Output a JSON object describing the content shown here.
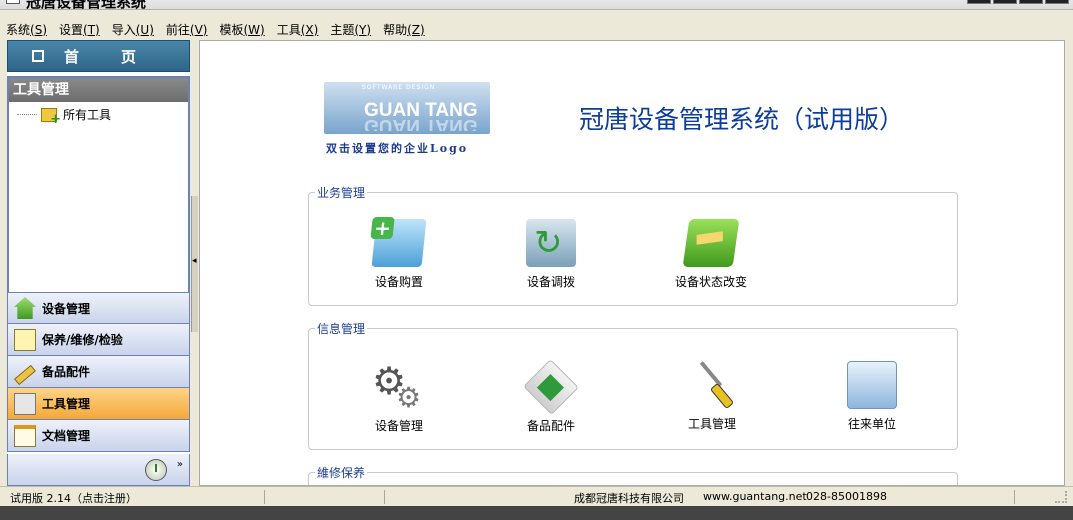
{
  "window": {
    "title": "冠唐设备管理系统"
  },
  "menubar": {
    "items": [
      {
        "label": "系统",
        "accel": "(S)"
      },
      {
        "label": "设置",
        "accel": "(T)"
      },
      {
        "label": "导入",
        "accel": "(U)"
      },
      {
        "label": "前往",
        "accel": "(V)"
      },
      {
        "label": "模板",
        "accel": "(W)"
      },
      {
        "label": "工具",
        "accel": "(X)"
      },
      {
        "label": "主题",
        "accel": "(Y)"
      },
      {
        "label": "帮助",
        "accel": "(Z)"
      }
    ]
  },
  "sidebar": {
    "home_label": "首页",
    "tree_header": "工具管理",
    "tree_item": "所有工具",
    "nav": [
      {
        "label": "设备管理",
        "icon": "house-icon"
      },
      {
        "label": "保养/维修/检验",
        "icon": "notepad-icon"
      },
      {
        "label": "备品配件",
        "icon": "ruler-icon"
      },
      {
        "label": "工具管理",
        "icon": "tools-icon",
        "active": true
      },
      {
        "label": "文档管理",
        "icon": "clipboard-icon"
      }
    ],
    "more_glyph": "»"
  },
  "main": {
    "logo": {
      "subtitle": "SOFTWARE DESIGN",
      "name": "GUAN TANG",
      "caption": "双击设置您的企业Logo"
    },
    "title": "冠唐设备管理系统（试用版）",
    "groups": [
      {
        "title": "业务管理",
        "tiles": [
          {
            "label": "设备购置",
            "icon": "folder-plus-icon"
          },
          {
            "label": "设备调拨",
            "icon": "transfer-icon"
          },
          {
            "label": "设备状态改变",
            "icon": "green-folder-icon"
          }
        ]
      },
      {
        "title": "信息管理",
        "tiles": [
          {
            "label": "设备管理",
            "icon": "gears-icon"
          },
          {
            "label": "备品配件",
            "icon": "cube-icon"
          },
          {
            "label": "工具管理",
            "icon": "screwdriver-icon"
          },
          {
            "label": "往来单位",
            "icon": "blue-folder-icon"
          }
        ]
      },
      {
        "title": "維修保养"
      }
    ]
  },
  "statusbar": {
    "version": "试用版 2.14（点击注册）",
    "company": "成都冠唐科技有限公司",
    "website": "www.guantang.net",
    "phone": "028-85001898"
  },
  "colors": {
    "accent_blue": "#0d3d9a",
    "group_title": "#1a3f97",
    "home_bar": "#2d6587",
    "active_nav": "#f4a83a"
  }
}
